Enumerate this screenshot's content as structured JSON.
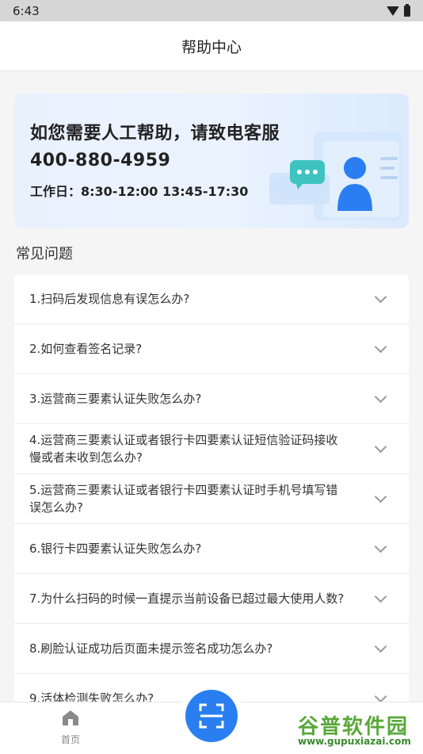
{
  "status_bar": {
    "time": "6:43"
  },
  "header": {
    "title": "帮助中心"
  },
  "banner": {
    "headline": "如您需要人工帮助，请致电客服",
    "phone": "400-880-4959",
    "hours": "工作日：8:30-12:00   13:45-17:30"
  },
  "faq": {
    "section_title": "常见问题",
    "items": [
      "1.扫码后发现信息有误怎么办?",
      "2.如何查看签名记录?",
      "3.运营商三要素认证失败怎么办?",
      "4.运营商三要素认证或者银行卡四要素认证短信验证码接收慢或者未收到怎么办?",
      "5.运营商三要素认证或者银行卡四要素认证时手机号填写错误怎么办?",
      "6.银行卡四要素认证失败怎么办?",
      "7.为什么扫码的时候一直提示当前设备已超过最大使用人数?",
      "8.刷脸认证成功后页面未提示签名成功怎么办?",
      "9.活体检测失败怎么办?"
    ]
  },
  "nav": {
    "home_label": "首页"
  },
  "watermark": {
    "title": "谷普软件园",
    "url": "www.gupuxiazai.com"
  },
  "colors": {
    "accent": "#2a7ff0",
    "background": "#f5f5f5"
  }
}
